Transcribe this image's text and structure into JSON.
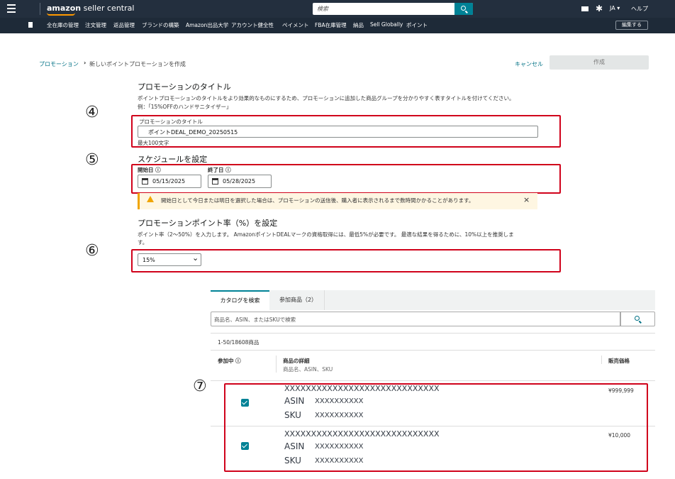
{
  "header": {
    "logo_bold": "amazon",
    "logo_rest": " seller central",
    "search_placeholder": "検索",
    "lang": "JA ▾",
    "help": "ヘルプ"
  },
  "nav": {
    "items": [
      "全在庫の管理",
      "注文管理",
      "返品管理",
      "ブランドの構築",
      "Amazon出品大学",
      "アカウント健全性",
      "ペイメント",
      "FBA在庫管理",
      "納品",
      "Sell Globally",
      "ポイント"
    ],
    "edit_label": "編集する"
  },
  "breadcrumb": {
    "root": "プロモーション",
    "sep": "›",
    "current": "新しいポイントプロモーションを作成"
  },
  "actions": {
    "cancel": "キャンセル",
    "create": "作成"
  },
  "markers": [
    "④",
    "⑤",
    "⑥",
    "⑦"
  ],
  "title_section": {
    "heading": "プロモーションのタイトル",
    "desc1": "ポイントプロモーションのタイトルをより効果的なものにするため、プロモーションに追加した商品グループを分かりやすく表すタイトルを付けてください。",
    "desc2": "例：「15%OFFのハンドサニタイザー」",
    "field_label": "プロモーションのタイトル",
    "field_value": "ポイントDEAL_DEMO_20250515",
    "max_hint": "最大100文字"
  },
  "schedule": {
    "heading": "スケジュールを設定",
    "start_label": "開始日 ⓘ",
    "start_value": "05/15/2025",
    "end_label": "終了日 ⓘ",
    "end_value": "05/28/2025",
    "warning": "開始日として今日または明日を選択した場合は、プロモーションの送信後、購入者に表示されるまで数時間かかることがあります。",
    "warning_close": "×"
  },
  "points": {
    "heading": "プロモーションポイント率（%）を設定",
    "desc1": "ポイント率（2〜50%）を入力します。 AmazonポイントDEALマークの資格取得には、最低5%が必要です。 最適な結果を得るために、10%以上を推奨しま",
    "desc2": "す。",
    "selected": "15%",
    "chevron": "⌄"
  },
  "catalog": {
    "tab_search": "カタログを検索",
    "tab_added": "参加商品（2）",
    "search_placeholder": "商品名、ASIN、またはSKUで検索",
    "count": "1-50/18608商品",
    "col_participating": "参加中 ⓘ",
    "col_details": "商品の詳細",
    "col_details_sub": "商品名、ASIN、SKU",
    "col_price": "販売価格",
    "rows": [
      {
        "name": "XXXXXXXXXXXXXXXXXXXXXXXXXXXXX",
        "asin_label": "ASIN",
        "asin": "XXXXXXXXXX",
        "sku_label": "SKU",
        "sku": "XXXXXXXXXX",
        "price": "¥999,999",
        "checked": true
      },
      {
        "name": "XXXXXXXXXXXXXXXXXXXXXXXXXXXXX",
        "asin_label": "ASIN",
        "asin": "XXXXXXXXXX",
        "sku_label": "SKU",
        "sku": "XXXXXXXXXX",
        "price": "¥10,000",
        "checked": true
      }
    ]
  },
  "colors": {
    "header_bg": "#232f3e",
    "teal": "#008296",
    "link": "#007185",
    "annotation_red": "#d0021b",
    "warning_bg": "#fef6e2",
    "warning_icon": "#f0a500"
  }
}
